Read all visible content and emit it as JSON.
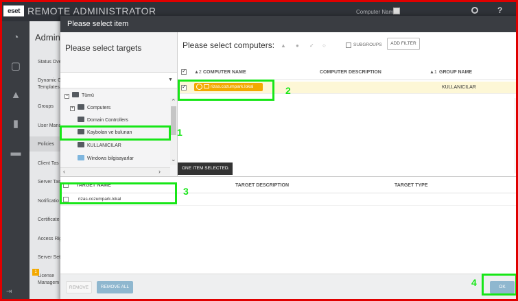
{
  "app": {
    "logo": "eset",
    "title": "REMOTE ADMINISTRATOR",
    "computer_name_label": "Computer Name",
    "help": "?"
  },
  "rail_icons": [
    "dashboard-icon",
    "computers-icon",
    "threats-icon",
    "reports-icon",
    "admin-icon"
  ],
  "admin": {
    "title": "Admin",
    "menu": [
      "Status Ove",
      "Dynamic G",
      "Templates",
      "Groups",
      "User Mana",
      "Policies",
      "Client Tas",
      "Server Tas",
      "Notificatio",
      "Certificate",
      "Access Rig",
      "Server Set",
      "License",
      "Managem"
    ],
    "badge": "1"
  },
  "dialog": {
    "title": "Please select item",
    "targets_title": "Please select targets",
    "tree": [
      {
        "label": "Tümü",
        "expander": "−"
      },
      {
        "label": "Computers",
        "expander": "+"
      },
      {
        "label": "Domain Controllers",
        "expander": ""
      },
      {
        "label": "Kaybolan ve bulunan",
        "expander": ""
      },
      {
        "label": "KULLANICILAR",
        "expander": ""
      },
      {
        "label": "Windows bilgisayarlar",
        "expander": ""
      }
    ],
    "computers_title": "Please select computers:",
    "subgroups": "SUBGROUPS",
    "add_filter": "ADD FILTER",
    "columns": {
      "name_sort": "▲2",
      "name": "COMPUTER NAME",
      "description": "COMPUTER DESCRIPTION",
      "group_sort": "▲1",
      "group": "GROUP NAME"
    },
    "computer_row": {
      "name": "rizas.cozumpark.lokal",
      "group": "KULLANICILAR"
    },
    "selected_info": "ONE ITEM SELECTED.",
    "target_columns": {
      "name": "TARGET NAME",
      "description": "TARGET DESCRIPTION",
      "type": "TARGET TYPE"
    },
    "target_row": {
      "name": "rizas.cozumpark.lokal"
    },
    "buttons": {
      "remove": "REMOVE",
      "remove_all": "REMOVE ALL",
      "ok": "OK"
    }
  },
  "callouts": [
    "1",
    "2",
    "3",
    "4"
  ],
  "colors": {
    "callout": "#17e617",
    "frame": "#e00000",
    "badge": "#f3a900",
    "button": "#8fb7cf"
  }
}
